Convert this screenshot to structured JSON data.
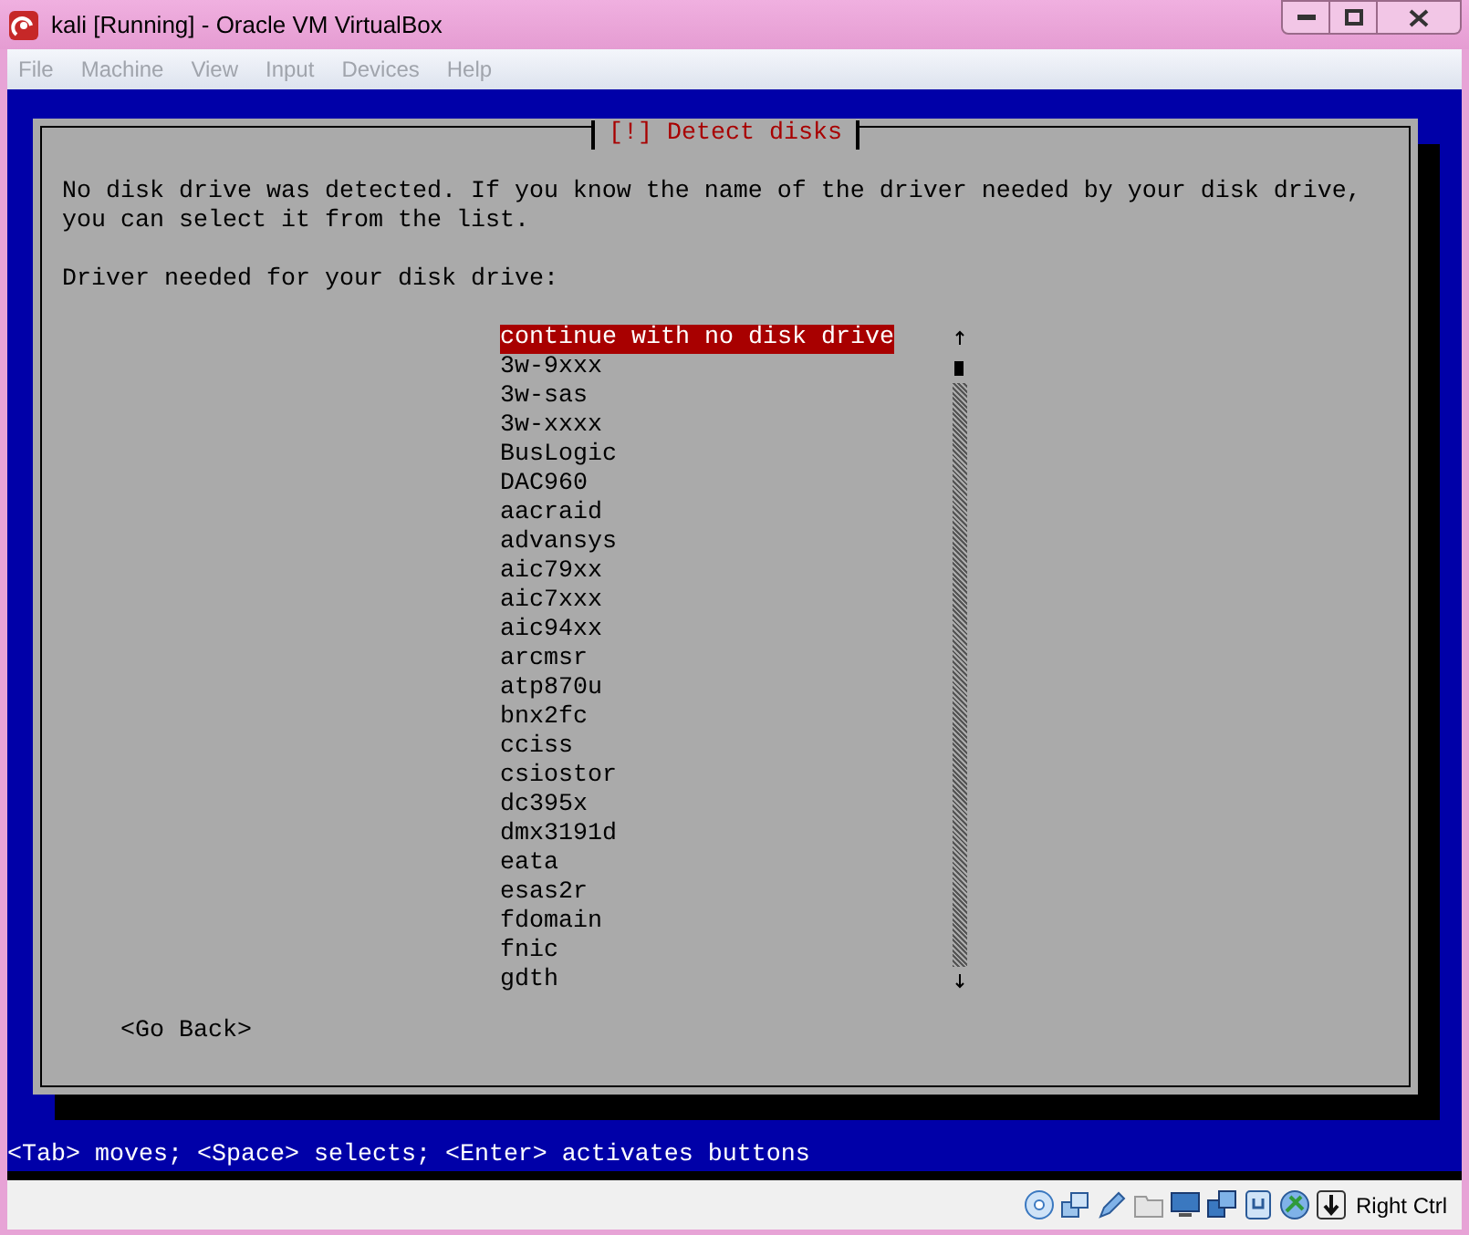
{
  "window": {
    "title": "kali [Running] - Oracle VM VirtualBox"
  },
  "menu": [
    {
      "label": "File",
      "disabled": true
    },
    {
      "label": "Machine",
      "disabled": true
    },
    {
      "label": "View",
      "disabled": true
    },
    {
      "label": "Input",
      "disabled": true
    },
    {
      "label": "Devices",
      "disabled": true
    },
    {
      "label": "Help",
      "disabled": true
    }
  ],
  "dialog": {
    "title": "[!] Detect disks",
    "message": "No disk drive was detected. If you know the name of the driver needed by your disk drive, you can select it from the list.",
    "prompt": "Driver needed for your disk drive:",
    "drivers": [
      {
        "label": "continue with no disk drive",
        "selected": true
      },
      {
        "label": "3w-9xxx",
        "selected": false
      },
      {
        "label": "3w-sas",
        "selected": false
      },
      {
        "label": "3w-xxxx",
        "selected": false
      },
      {
        "label": "BusLogic",
        "selected": false
      },
      {
        "label": "DAC960",
        "selected": false
      },
      {
        "label": "aacraid",
        "selected": false
      },
      {
        "label": "advansys",
        "selected": false
      },
      {
        "label": "aic79xx",
        "selected": false
      },
      {
        "label": "aic7xxx",
        "selected": false
      },
      {
        "label": "aic94xx",
        "selected": false
      },
      {
        "label": "arcmsr",
        "selected": false
      },
      {
        "label": "atp870u",
        "selected": false
      },
      {
        "label": "bnx2fc",
        "selected": false
      },
      {
        "label": "cciss",
        "selected": false
      },
      {
        "label": "csiostor",
        "selected": false
      },
      {
        "label": "dc395x",
        "selected": false
      },
      {
        "label": "dmx3191d",
        "selected": false
      },
      {
        "label": "eata",
        "selected": false
      },
      {
        "label": "esas2r",
        "selected": false
      },
      {
        "label": "fdomain",
        "selected": false
      },
      {
        "label": "fnic",
        "selected": false
      },
      {
        "label": "gdth",
        "selected": false
      }
    ],
    "back_button": "<Go Back>"
  },
  "help_line": "<Tab> moves; <Space> selects; <Enter> activates buttons",
  "status_bar": {
    "host_key": "Right Ctrl"
  }
}
